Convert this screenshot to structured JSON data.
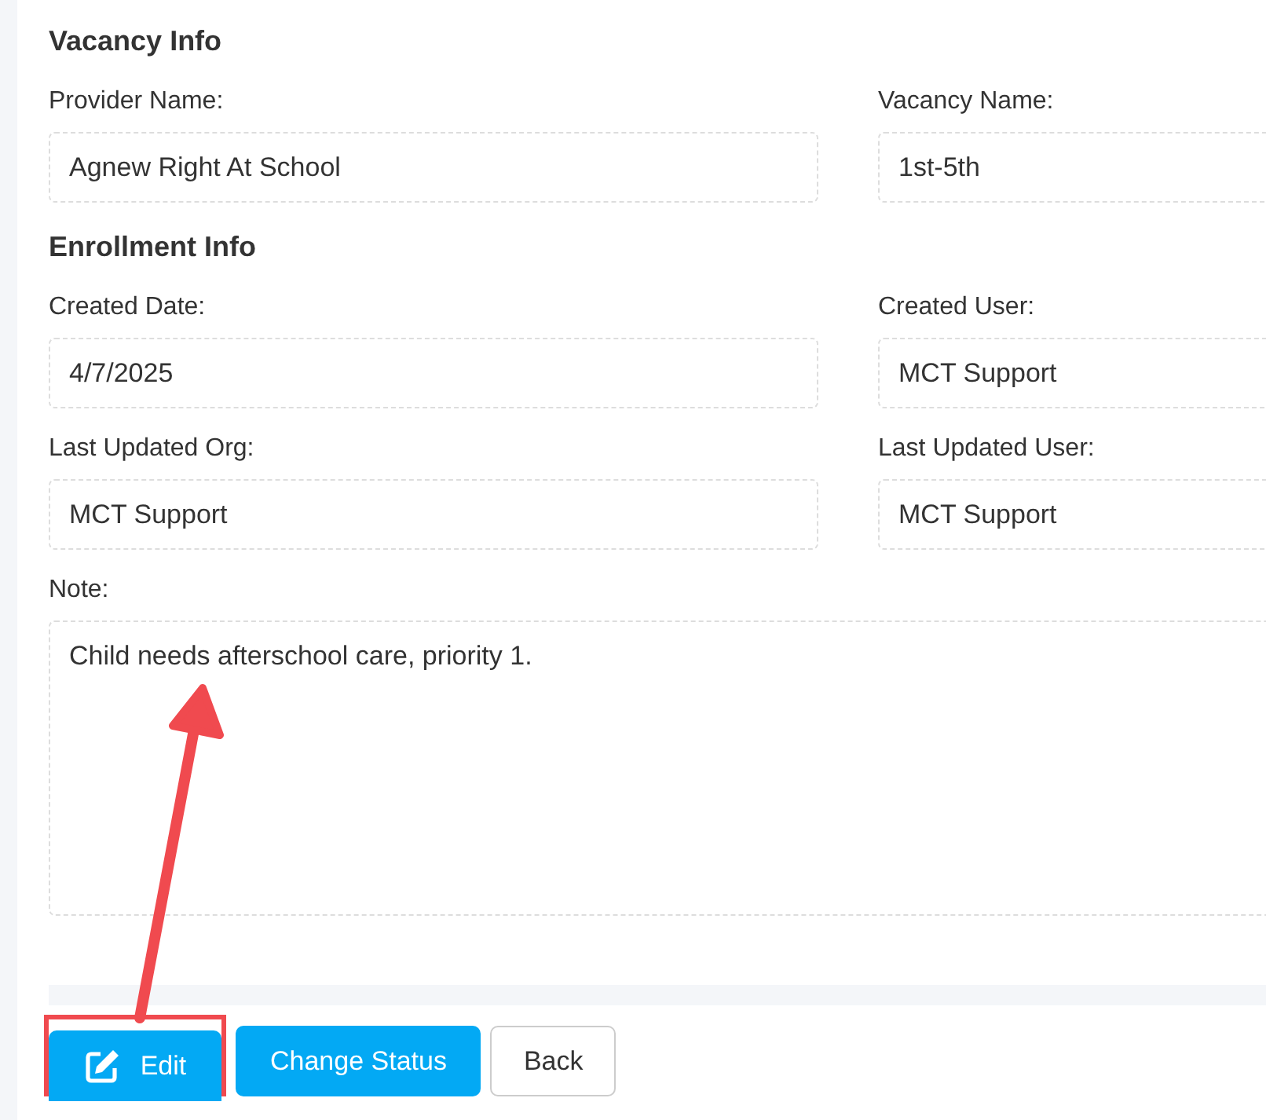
{
  "sections": [
    {
      "title": "Vacancy Info",
      "fields": [
        {
          "label": "Provider Name:",
          "value": "Agnew Right At School",
          "kind": "input"
        },
        {
          "label": "Vacancy Name:",
          "value": "1st-5th",
          "kind": "input"
        }
      ]
    },
    {
      "title": "Enrollment Info",
      "fields": [
        {
          "label": "Created Date:",
          "value": "4/7/2025",
          "kind": "input"
        },
        {
          "label": "Created User:",
          "value": "MCT Support",
          "kind": "input"
        },
        {
          "label": "Last Updated Org:",
          "value": "MCT Support",
          "kind": "input"
        },
        {
          "label": "Last Updated User:",
          "value": "MCT Support",
          "kind": "input"
        },
        {
          "label": "Note:",
          "value": "Child needs afterschool care, priority 1.",
          "kind": "textarea"
        }
      ]
    }
  ],
  "buttons": [
    {
      "label": "Edit",
      "kind": "edit",
      "highlighted": true
    },
    {
      "label": "Change Status",
      "kind": "primary",
      "highlighted": false
    },
    {
      "label": "Back",
      "kind": "default",
      "highlighted": false
    }
  ]
}
